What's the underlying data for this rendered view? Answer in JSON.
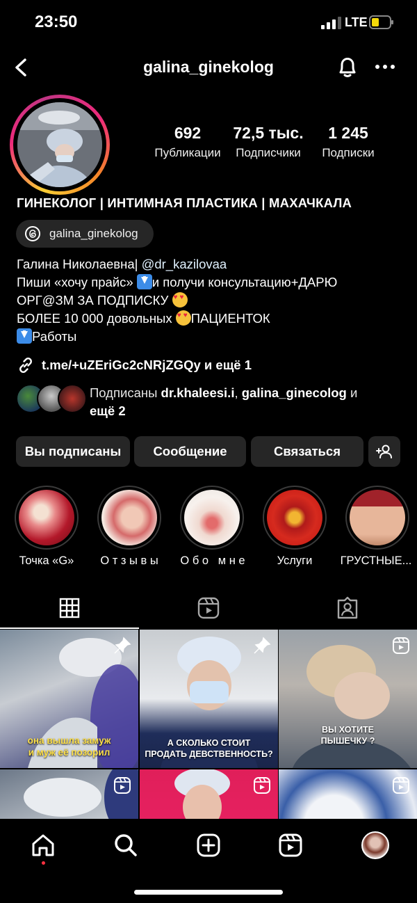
{
  "status_bar": {
    "time": "23:50",
    "network": "LTE"
  },
  "header": {
    "username": "galina_ginekolog"
  },
  "stats": [
    {
      "value": "692",
      "label": "Публикации"
    },
    {
      "value": "72,5 тыс.",
      "label": "Подписчики"
    },
    {
      "value": "1 245",
      "label": "Подписки"
    }
  ],
  "profile": {
    "category_title": "ГИНЕКОЛОГ | ИНТИМНАЯ ПЛАСТИКА | МАХАЧКАЛА",
    "threads_handle": "galina_ginekolog",
    "bio": {
      "line1_name": "Галина Николаевна| ",
      "line1_mention": "@dr_kazilovaa",
      "line2_a": "Пиши «хочу прайс» ",
      "line2_b": "и получи консультацию+ДАРЮ",
      "line3": "ОРГ@ЗМ ЗА ПОДПИСКУ ",
      "line4_a": "БОЛЕЕ 10 000 довольных ",
      "line4_b": "ПАЦИЕНТОК",
      "line5": "Работы"
    },
    "link_text": "t.me/+uZEriGc2cNRjZGQy и ещё 1",
    "followed_by": {
      "prefix": "Подписаны ",
      "user1": "dr.khaleesi.i",
      "separator": ", ",
      "user2": "galina_ginecolog",
      "suffix": " и",
      "more": "ещё 2"
    }
  },
  "actions": {
    "following": "Вы подписаны",
    "message": "Сообщение",
    "contact": "Связаться"
  },
  "highlights": [
    {
      "label": "Точка «G»"
    },
    {
      "label": "О т з ы в ы"
    },
    {
      "label": "О б о   м н е"
    },
    {
      "label": "Услуги"
    },
    {
      "label": "ГРУСТНЫЕ..."
    }
  ],
  "posts": [
    {
      "caption": "она вышла замуж\nи муж её позорил",
      "pinned": true
    },
    {
      "caption": "А СКОЛЬКО СТОИТ\nПРОДАТЬ ДЕВСТВЕННОСТЬ?",
      "pinned": true
    },
    {
      "caption": "ВЫ ХОТИТЕ\nПЫШЕЧКУ ?",
      "pinned": false
    },
    {
      "caption": "",
      "pinned": false
    },
    {
      "caption": "",
      "pinned": false
    },
    {
      "caption": "",
      "pinned": false
    }
  ],
  "colors": {
    "background": "#000000",
    "button": "#262626",
    "notification_dot": "#ff3040"
  }
}
